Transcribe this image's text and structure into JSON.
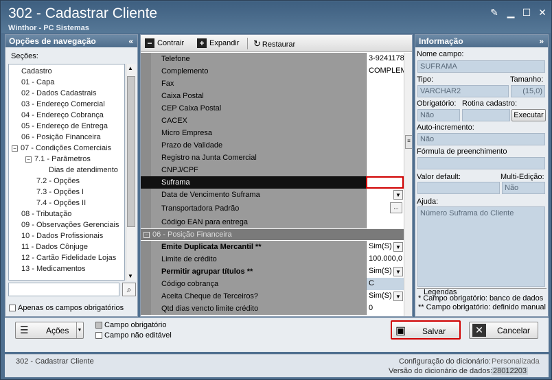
{
  "window": {
    "title": "302 - Cadastrar Cliente",
    "subtitle": "Winthor - PC Sistemas"
  },
  "nav": {
    "header": "Opções de navegação",
    "section_label": "Seções:",
    "items": [
      "Cadastro",
      "01 - Capa",
      "02 - Dados Cadastrais",
      "03 - Endereço Comercial",
      "04 - Endereço Cobrança",
      "05 - Endereço de Entrega",
      "06 - Posição Financeira",
      "07 - Condições Comerciais",
      "7.1 - Parâmetros",
      "Dias de atendimento",
      "7.2 - Opções",
      "7.3 - Opções I",
      "7.4 - Opções II",
      "08 - Tributação",
      "09 - Observações Gerenciais",
      "10 - Dados Profissionais",
      "11 - Dados Cônjuge",
      "12 - Cartão Fidelidade Lojas",
      "13 - Medicamentos"
    ],
    "only_required_label": "Apenas os campos obrigatórios"
  },
  "toolbar": {
    "collapse": "Contrair",
    "expand": "Expandir",
    "restore": "Restaurar"
  },
  "grid": {
    "rows": [
      {
        "label": "Telefone",
        "value": "3-9241178"
      },
      {
        "label": "Complemento",
        "value": "COMPLEMI"
      },
      {
        "label": "Fax",
        "value": ""
      },
      {
        "label": "Caixa Postal",
        "value": ""
      },
      {
        "label": "CEP Caixa Postal",
        "value": ""
      },
      {
        "label": "CACEX",
        "value": ""
      },
      {
        "label": "Micro Empresa",
        "value": ""
      },
      {
        "label": "Prazo de Validade",
        "value": ""
      },
      {
        "label": "Registro na Junta Comercial",
        "value": ""
      },
      {
        "label": "CNPJ/CPF",
        "value": ""
      },
      {
        "label": "Suframa",
        "value": ""
      },
      {
        "label": "Data de Vencimento Suframa",
        "value": ""
      },
      {
        "label": "Transportadora Padrão",
        "value": ""
      },
      {
        "label": "Código EAN para entrega",
        "value": ""
      }
    ],
    "section": "06 - Posição Financeira",
    "rows2": [
      {
        "label": "Emite Duplicata Mercantil **",
        "value": "Sim(S)"
      },
      {
        "label": "Limite de crédito",
        "value": "100.000,0"
      },
      {
        "label": "Permitir agrupar títulos **",
        "value": "Sim(S)"
      },
      {
        "label": "Código cobrança",
        "value": "C"
      },
      {
        "label": "Aceita Cheque de Terceiros?",
        "value": "Sim(S)"
      },
      {
        "label": "Qtd dias vencto limite crédito",
        "value": "0"
      }
    ]
  },
  "info": {
    "header": "Informação",
    "field_name_label": "Nome campo:",
    "field_name": "SUFRAMA",
    "type_label": "Tipo:",
    "type": "VARCHAR2",
    "size_label": "Tamanho:",
    "size": "(15,0)",
    "required_label": "Obrigatório:",
    "required": "Não",
    "routine_label": "Rotina cadastro:",
    "execute_label": "Executar",
    "auto_inc_label": "Auto-incremento:",
    "auto_inc": "Não",
    "formula_label": "Fórmula de preenchimento",
    "default_label": "Valor default:",
    "multi_edit_label": "Multi-Edição:",
    "multi_edit": "Não",
    "help_label": "Ajuda:",
    "help_text": "Número Suframa do Cliente",
    "legend_title": "Legendas",
    "legend1": "* Campo obrigatório: banco de dados",
    "legend2": "** Campo obrigatório: definido manual"
  },
  "actions": {
    "actions_label": "Ações",
    "legend_required": "Campo obrigatório",
    "legend_noneditable": "Campo não editável",
    "save_label": "Salvar",
    "cancel_label": "Cancelar"
  },
  "status": {
    "left": "302 - Cadastrar Cliente",
    "dict_config_label": "Configuração do dicionário:",
    "dict_config": "Personalizada",
    "dict_version_label": "Versão do dicionário de dados:",
    "dict_version": "28012203"
  }
}
